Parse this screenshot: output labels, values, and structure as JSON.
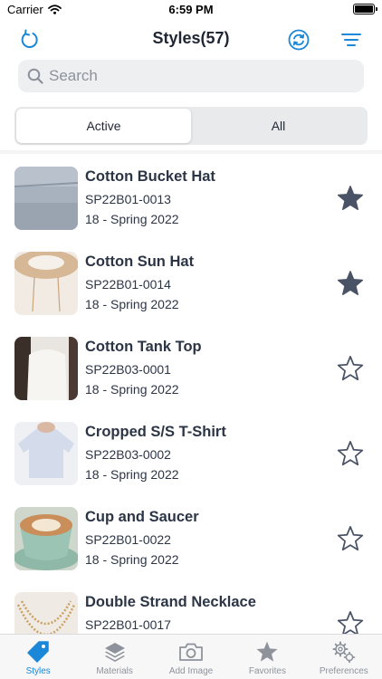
{
  "status_bar": {
    "carrier": "Carrier",
    "time": "6:59 PM"
  },
  "header": {
    "title": "Styles(57)"
  },
  "search": {
    "placeholder": "Search"
  },
  "segments": {
    "active_label": "Active",
    "all_label": "All",
    "selected": "Active"
  },
  "colors": {
    "accent": "#1a87d8",
    "text": "#2c3546",
    "star": "#4a5366"
  },
  "styles": [
    {
      "name": "Cotton Bucket Hat",
      "code": "SP22B01-0013",
      "season": "18 - Spring 2022",
      "favorite": true
    },
    {
      "name": "Cotton Sun Hat",
      "code": "SP22B01-0014",
      "season": "18 - Spring 2022",
      "favorite": true
    },
    {
      "name": "Cotton Tank Top",
      "code": "SP22B03-0001",
      "season": "18 - Spring 2022",
      "favorite": false
    },
    {
      "name": "Cropped S/S T-Shirt",
      "code": "SP22B03-0002",
      "season": "18 - Spring 2022",
      "favorite": false
    },
    {
      "name": "Cup and Saucer",
      "code": "SP22B01-0022",
      "season": "18 - Spring 2022",
      "favorite": false
    },
    {
      "name": "Double Strand Necklace",
      "code": "SP22B01-0017",
      "season": "",
      "favorite": false
    }
  ],
  "tab_bar": {
    "tabs": [
      {
        "label": "Styles",
        "icon": "tag-icon",
        "active": true
      },
      {
        "label": "Materials",
        "icon": "layers-icon",
        "active": false
      },
      {
        "label": "Add Image",
        "icon": "camera-icon",
        "active": false
      },
      {
        "label": "Favorites",
        "icon": "star-icon",
        "active": false
      },
      {
        "label": "Preferences",
        "icon": "gears-icon",
        "active": false
      }
    ]
  }
}
